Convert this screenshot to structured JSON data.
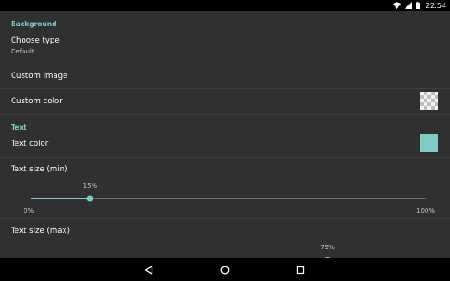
{
  "status_bar": {
    "time": "22:54",
    "icons": [
      "wifi-icon",
      "signal-icon",
      "battery-icon"
    ]
  },
  "background_section": {
    "header": "Background",
    "choose_type": {
      "title": "Choose type",
      "summary": "Default"
    },
    "custom_image": {
      "title": "Custom image"
    },
    "custom_color": {
      "title": "Custom color",
      "swatch": "transparent-checkerboard"
    }
  },
  "text_section": {
    "header": "Text",
    "text_color": {
      "title": "Text color",
      "swatch_color": "#80cbc4"
    },
    "text_size_min": {
      "title": "Text size (min)",
      "value_label": "15%",
      "value": 15,
      "min_label": "0%",
      "max_label": "100%"
    },
    "text_size_max": {
      "title": "Text size (max)",
      "value_label": "75%",
      "value": 75
    }
  },
  "nav_bar": {
    "buttons": [
      "back-icon",
      "home-icon",
      "recents-icon"
    ]
  },
  "colors": {
    "accent": "#80cbc4",
    "background": "#303030",
    "divider": "#3f3f3f"
  }
}
